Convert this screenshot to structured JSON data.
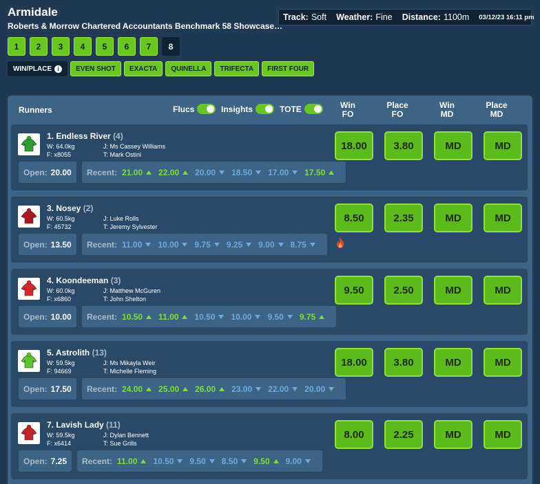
{
  "header": {
    "venue": "Armidale",
    "race_name": "Roberts & Morrow Chartered Accountants Benchmark 58 Showcase…",
    "track_label": "Track:",
    "track_value": "Soft",
    "weather_label": "Weather:",
    "weather_value": "Fine",
    "distance_label": "Distance:",
    "distance_value": "1100m",
    "datetime": "03/12/23 16:11 pm"
  },
  "race_tabs": [
    "1",
    "2",
    "3",
    "4",
    "5",
    "6",
    "7",
    "8"
  ],
  "active_race": "8",
  "bet_types": {
    "win_place": "WIN/PLACE",
    "info_glyph": "i",
    "options": [
      "EVEN SHOT",
      "EXACTA",
      "QUINELLA",
      "TRIFECTA",
      "FIRST FOUR"
    ]
  },
  "table": {
    "runners_label": "Runners",
    "toggles": [
      "Flucs",
      "Insights",
      "TOTE"
    ],
    "columns": [
      {
        "line1": "Win",
        "line2": "FO"
      },
      {
        "line1": "Place",
        "line2": "FO"
      },
      {
        "line1": "Win",
        "line2": "MD"
      },
      {
        "line1": "Place",
        "line2": "MD"
      }
    ]
  },
  "open_label": "Open:",
  "recent_label": "Recent:",
  "runners": [
    {
      "name": "1. Endless River",
      "barrier": "(4)",
      "weight": "W: 64.0kg",
      "form": "F: x8055",
      "jockey": "J: Ms Cassey Williams",
      "trainer": "T: Mark Ostini",
      "open": "20.00",
      "recent": [
        {
          "v": "21.00",
          "d": "up"
        },
        {
          "v": "22.00",
          "d": "up"
        },
        {
          "v": "20.00",
          "d": "down"
        },
        {
          "v": "18.50",
          "d": "down"
        },
        {
          "v": "17.00",
          "d": "down"
        },
        {
          "v": "17.50",
          "d": "up"
        }
      ],
      "odds": [
        "18.00",
        "3.80",
        "MD",
        "MD"
      ],
      "silk_color": "#2e9e2e",
      "hot": false
    },
    {
      "name": "3. Nosey",
      "barrier": "(2)",
      "weight": "W: 60.5kg",
      "form": "F: 45732",
      "jockey": "J: Luke Rolls",
      "trainer": "T: Jeremy Sylvester",
      "open": "13.50",
      "recent": [
        {
          "v": "11.00",
          "d": "down"
        },
        {
          "v": "10.00",
          "d": "down"
        },
        {
          "v": "9.75",
          "d": "down"
        },
        {
          "v": "9.25",
          "d": "down"
        },
        {
          "v": "9.00",
          "d": "down"
        },
        {
          "v": "8.75",
          "d": "down"
        }
      ],
      "odds": [
        "8.50",
        "2.35",
        "MD",
        "MD"
      ],
      "silk_color": "#b0161d",
      "hot": true
    },
    {
      "name": "4. Koondeeman",
      "barrier": "(3)",
      "weight": "W: 60.0kg",
      "form": "F: x6860",
      "jockey": "J: Matthew McGuren",
      "trainer": "T: John Shelton",
      "open": "10.00",
      "recent": [
        {
          "v": "10.50",
          "d": "up"
        },
        {
          "v": "11.00",
          "d": "up"
        },
        {
          "v": "10.50",
          "d": "down"
        },
        {
          "v": "10.00",
          "d": "down"
        },
        {
          "v": "9.50",
          "d": "down"
        },
        {
          "v": "9.75",
          "d": "up"
        }
      ],
      "odds": [
        "9.50",
        "2.50",
        "MD",
        "MD"
      ],
      "silk_color": "#d8262a",
      "hot": false
    },
    {
      "name": "5. Astrolith",
      "barrier": "(13)",
      "weight": "W: 59.5kg",
      "form": "F: 94669",
      "jockey": "J: Ms Mikayla Weir",
      "trainer": "T: Michelle Fleming",
      "open": "17.50",
      "recent": [
        {
          "v": "24.00",
          "d": "up"
        },
        {
          "v": "25.00",
          "d": "up"
        },
        {
          "v": "26.00",
          "d": "up"
        },
        {
          "v": "23.00",
          "d": "down"
        },
        {
          "v": "22.00",
          "d": "down"
        },
        {
          "v": "20.00",
          "d": "down"
        }
      ],
      "odds": [
        "18.00",
        "3.80",
        "MD",
        "MD"
      ],
      "silk_color": "#5cc72a",
      "hot": false
    },
    {
      "name": "7. Lavish Lady",
      "barrier": "(11)",
      "weight": "W: 59.5kg",
      "form": "F: x6414",
      "jockey": "J: Dylan Bennett",
      "trainer": "T: Sue Grills",
      "open": "7.25",
      "recent": [
        {
          "v": "11.00",
          "d": "up"
        },
        {
          "v": "10.50",
          "d": "down"
        },
        {
          "v": "9.50",
          "d": "down"
        },
        {
          "v": "8.50",
          "d": "down"
        },
        {
          "v": "9.50",
          "d": "up"
        },
        {
          "v": "9.00",
          "d": "down"
        }
      ],
      "odds": [
        "8.00",
        "2.25",
        "MD",
        "MD"
      ],
      "silk_color": "#c8202a",
      "hot": false
    }
  ]
}
